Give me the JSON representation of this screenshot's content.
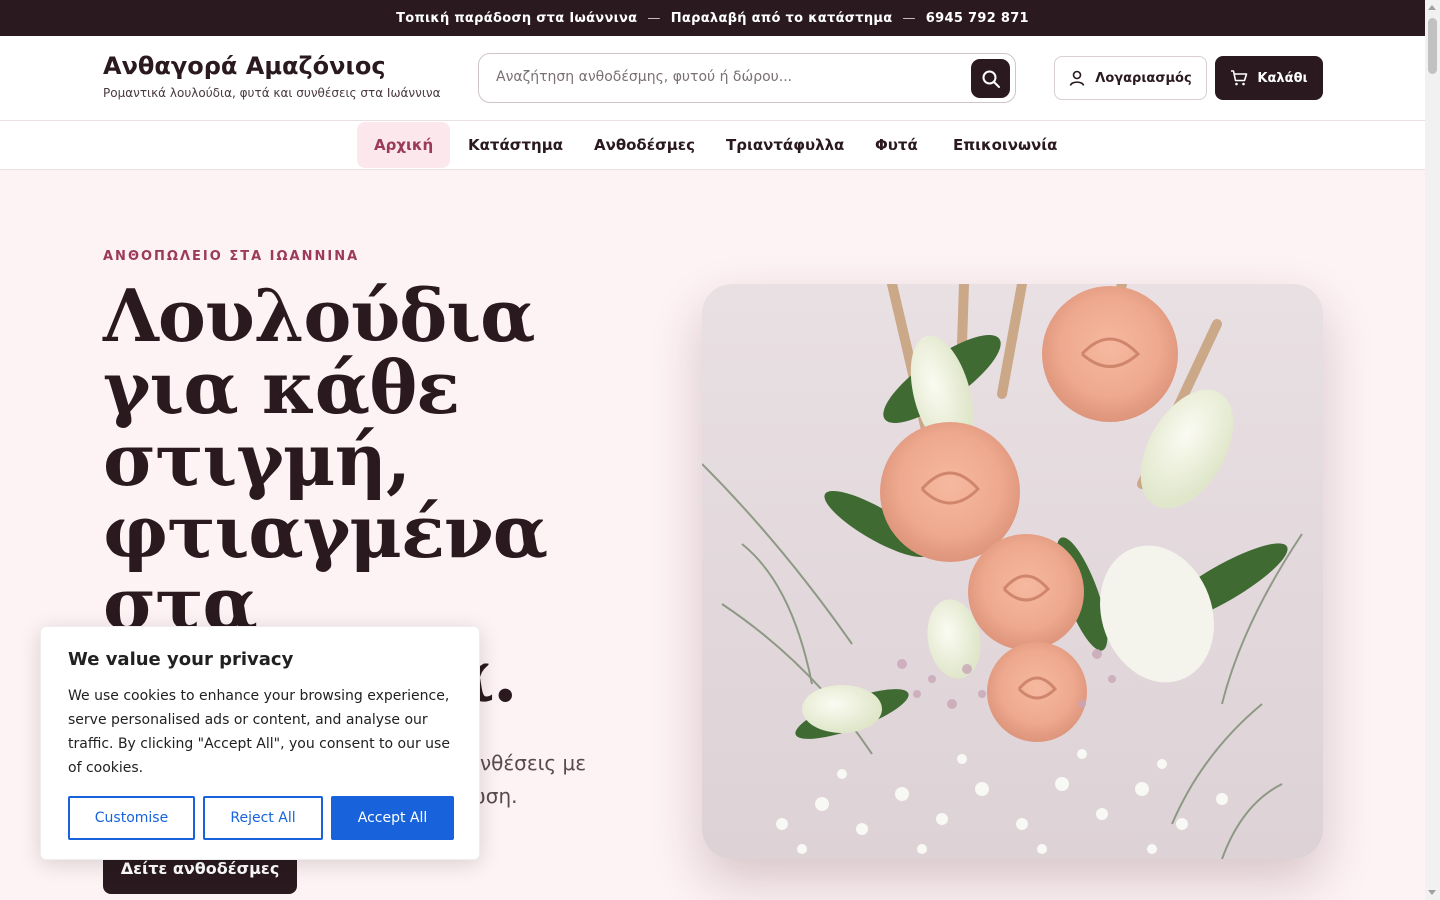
{
  "topbar": {
    "delivery": "Τοπική παράδοση στα Ιωάννινα",
    "pickup": "Παραλαβή από το κατάστημα",
    "phone": "6945 792 871",
    "separator": "—"
  },
  "header": {
    "brand_title": "Ανθαγορά Αμαζόνιος",
    "brand_subtitle": "Ρομαντικά λουλούδια, φυτά και συνθέσεις στα Ιωάννινα",
    "search_placeholder": "Αναζήτηση ανθοδέσμης, φυτού ή δώρου...",
    "account_label": "Λογαριασμός",
    "cart_label": "Καλάθι"
  },
  "nav": {
    "items": [
      {
        "label": "Αρχική",
        "active": true
      },
      {
        "label": "Κατάστημα",
        "active": false
      },
      {
        "label": "Ανθοδέσμες",
        "active": false
      },
      {
        "label": "Τριαντάφυλλα",
        "active": false
      },
      {
        "label": "Φυτά",
        "active": false
      },
      {
        "label": "Επικοινωνία",
        "active": false
      }
    ]
  },
  "hero": {
    "eyebrow": "ΑΝΘΟΠΩΛΕΙΟ ΣΤΑ ΙΩΑΝΝΙΝΑ",
    "headline": "Λουλούδια για κάθε στιγμή, φτιαγμένα στα Ιωάννινα.",
    "lead": "Φρέσκα λουλούδια και ρομαντικές συνθέσεις με τοπική παράδοση μετά από επιβεβαίωση.",
    "cta_label": "Δείτε ανθοδέσμες"
  },
  "cookie": {
    "title": "We value your privacy",
    "body": "We use cookies to enhance your browsing experience, serve personalised ads or content, and analyse our traffic. By clicking \"Accept All\", you consent to our use of cookies.",
    "customise_label": "Customise",
    "reject_label": "Reject All",
    "accept_label": "Accept All"
  },
  "colors": {
    "primary": "#2a1a1f",
    "accent": "#9b3a5a",
    "hero_bg": "#fdf2f4",
    "consent_blue": "#1863dc"
  },
  "icons": {
    "search": "search-icon",
    "account": "user-icon",
    "cart": "cart-icon"
  }
}
